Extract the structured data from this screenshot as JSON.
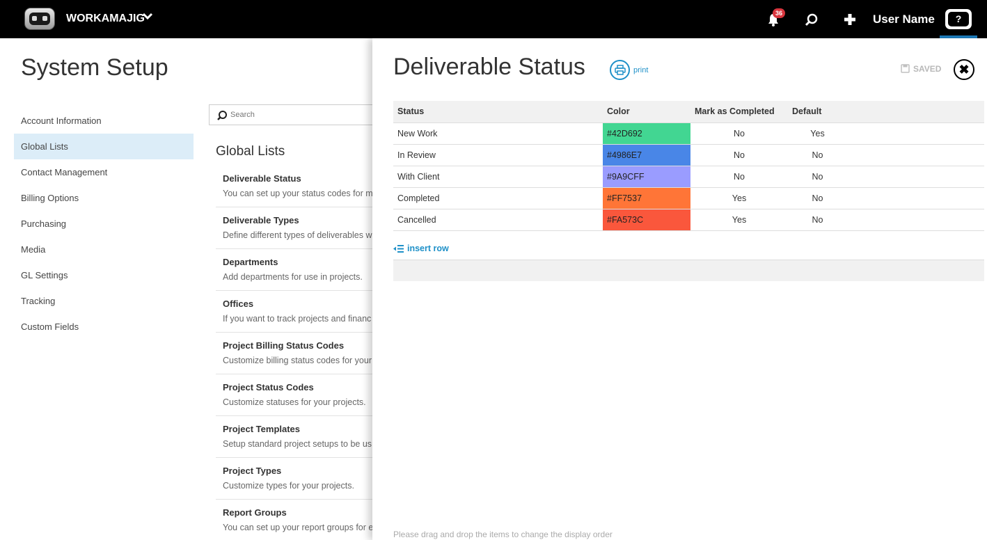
{
  "topbar": {
    "brand": "WORKAMAJIG",
    "notification_count": "36",
    "user_name": "User Name",
    "help_label": "?"
  },
  "page": {
    "title": "System Setup",
    "side_nav": [
      {
        "label": "Account Information"
      },
      {
        "label": "Global Lists",
        "active": true
      },
      {
        "label": "Contact Management"
      },
      {
        "label": "Billing Options"
      },
      {
        "label": "Purchasing"
      },
      {
        "label": "Media"
      },
      {
        "label": "GL Settings"
      },
      {
        "label": "Tracking"
      },
      {
        "label": "Custom Fields"
      }
    ],
    "search_placeholder": "Search",
    "global_lists_heading": "Global Lists",
    "global_lists": [
      {
        "title": "Deliverable Status",
        "desc": "You can set up your status codes for m"
      },
      {
        "title": "Deliverable Types",
        "desc": "Define different types of deliverables w"
      },
      {
        "title": "Departments",
        "desc": "Add departments for use in projects."
      },
      {
        "title": "Offices",
        "desc": "If you want to track projects and financ"
      },
      {
        "title": "Project Billing Status Codes",
        "desc": "Customize billing status codes for your"
      },
      {
        "title": "Project Status Codes",
        "desc": "Customize statuses for your projects."
      },
      {
        "title": "Project Templates",
        "desc": "Setup standard project setups to be us"
      },
      {
        "title": "Project Types",
        "desc": "Customize types for your projects."
      },
      {
        "title": "Report Groups",
        "desc": "You can set up your report groups for e"
      }
    ]
  },
  "panel": {
    "title": "Deliverable Status",
    "print_label": "print",
    "saved_label": "SAVED",
    "close_symbol": "✖",
    "columns": {
      "status": "Status",
      "color": "Color",
      "mark_completed": "Mark as Completed",
      "default": "Default"
    },
    "rows": [
      {
        "status": "New Work",
        "color": "#42D692",
        "mark_completed": "No",
        "default": "Yes"
      },
      {
        "status": "In Review",
        "color": "#4986E7",
        "mark_completed": "No",
        "default": "No"
      },
      {
        "status": "With Client",
        "color": "#9A9CFF",
        "mark_completed": "No",
        "default": "No"
      },
      {
        "status": "Completed",
        "color": "#FF7537",
        "mark_completed": "Yes",
        "default": "No"
      },
      {
        "status": "Cancelled",
        "color": "#FA573C",
        "mark_completed": "Yes",
        "default": "No"
      }
    ],
    "insert_row_label": "insert row",
    "drag_note": "Please drag and drop the items to change the display order"
  },
  "colors": {
    "accent": "#1e90c8",
    "active_nav_bg": "#dcedf8",
    "badge": "#d9363e"
  }
}
